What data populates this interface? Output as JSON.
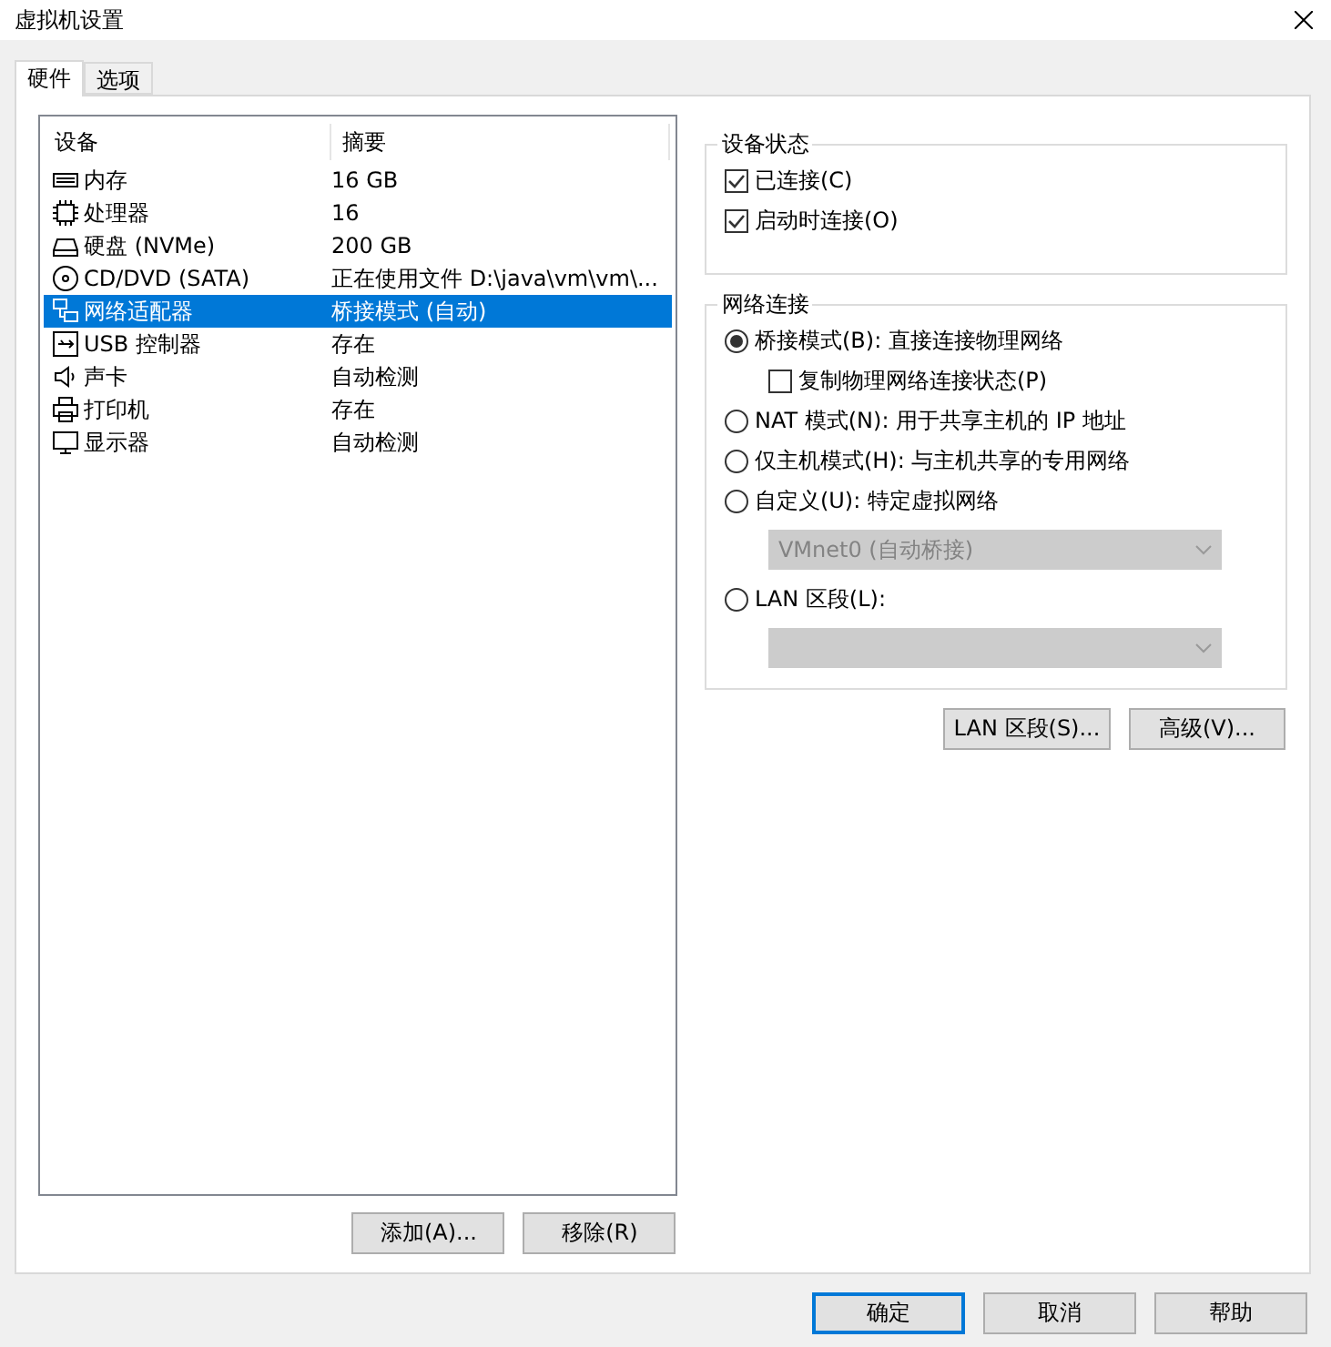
{
  "window": {
    "title": "虚拟机设置"
  },
  "tabs": [
    {
      "label": "硬件",
      "selected": true
    },
    {
      "label": "选项",
      "selected": false
    }
  ],
  "device_list": {
    "columns": [
      "设备",
      "摘要"
    ],
    "rows": [
      {
        "device": "内存",
        "summary": "16 GB",
        "selected": false
      },
      {
        "device": "处理器",
        "summary": "16",
        "selected": false
      },
      {
        "device": "硬盘 (NVMe)",
        "summary": "200 GB",
        "selected": false
      },
      {
        "device": "CD/DVD (SATA)",
        "summary": "正在使用文件 D:\\java\\vm\\vm\\...",
        "selected": false
      },
      {
        "device": "网络适配器",
        "summary": "桥接模式 (自动)",
        "selected": true
      },
      {
        "device": "USB 控制器",
        "summary": "存在",
        "selected": false
      },
      {
        "device": "声卡",
        "summary": "自动检测",
        "selected": false
      },
      {
        "device": "打印机",
        "summary": "存在",
        "selected": false
      },
      {
        "device": "显示器",
        "summary": "自动检测",
        "selected": false
      }
    ]
  },
  "list_buttons": [
    "添加(A)...",
    "移除(R)"
  ],
  "device_status": {
    "title": "设备状态",
    "options": [
      {
        "label": "已连接(C)",
        "checked": true
      },
      {
        "label": "启动时连接(O)",
        "checked": true
      }
    ]
  },
  "network_connection": {
    "title": "网络连接",
    "items": [
      {
        "kind": "radio",
        "label": "桥接模式(B): 直接连接物理网络",
        "selected": true
      },
      {
        "kind": "checkbox",
        "label": "复制物理网络连接状态(P)",
        "checked": false
      },
      {
        "kind": "radio",
        "label": "NAT 模式(N): 用于共享主机的 IP 地址",
        "selected": false
      },
      {
        "kind": "radio",
        "label": "仅主机模式(H): 与主机共享的专用网络",
        "selected": false
      },
      {
        "kind": "radio",
        "label": "自定义(U): 特定虚拟网络",
        "selected": false
      },
      {
        "kind": "dropdown",
        "value": "VMnet0 (自动桥接)",
        "disabled": true
      },
      {
        "kind": "radio",
        "label": "LAN 区段(L):",
        "selected": false
      },
      {
        "kind": "dropdown",
        "disabled": true
      }
    ]
  },
  "network_buttons": [
    "LAN 区段(S)...",
    "高级(V)..."
  ],
  "dialog_buttons": [
    {
      "label": "确定",
      "default": true
    },
    {
      "label": "取消",
      "default": false
    },
    {
      "label": "帮助",
      "default": false
    }
  ]
}
